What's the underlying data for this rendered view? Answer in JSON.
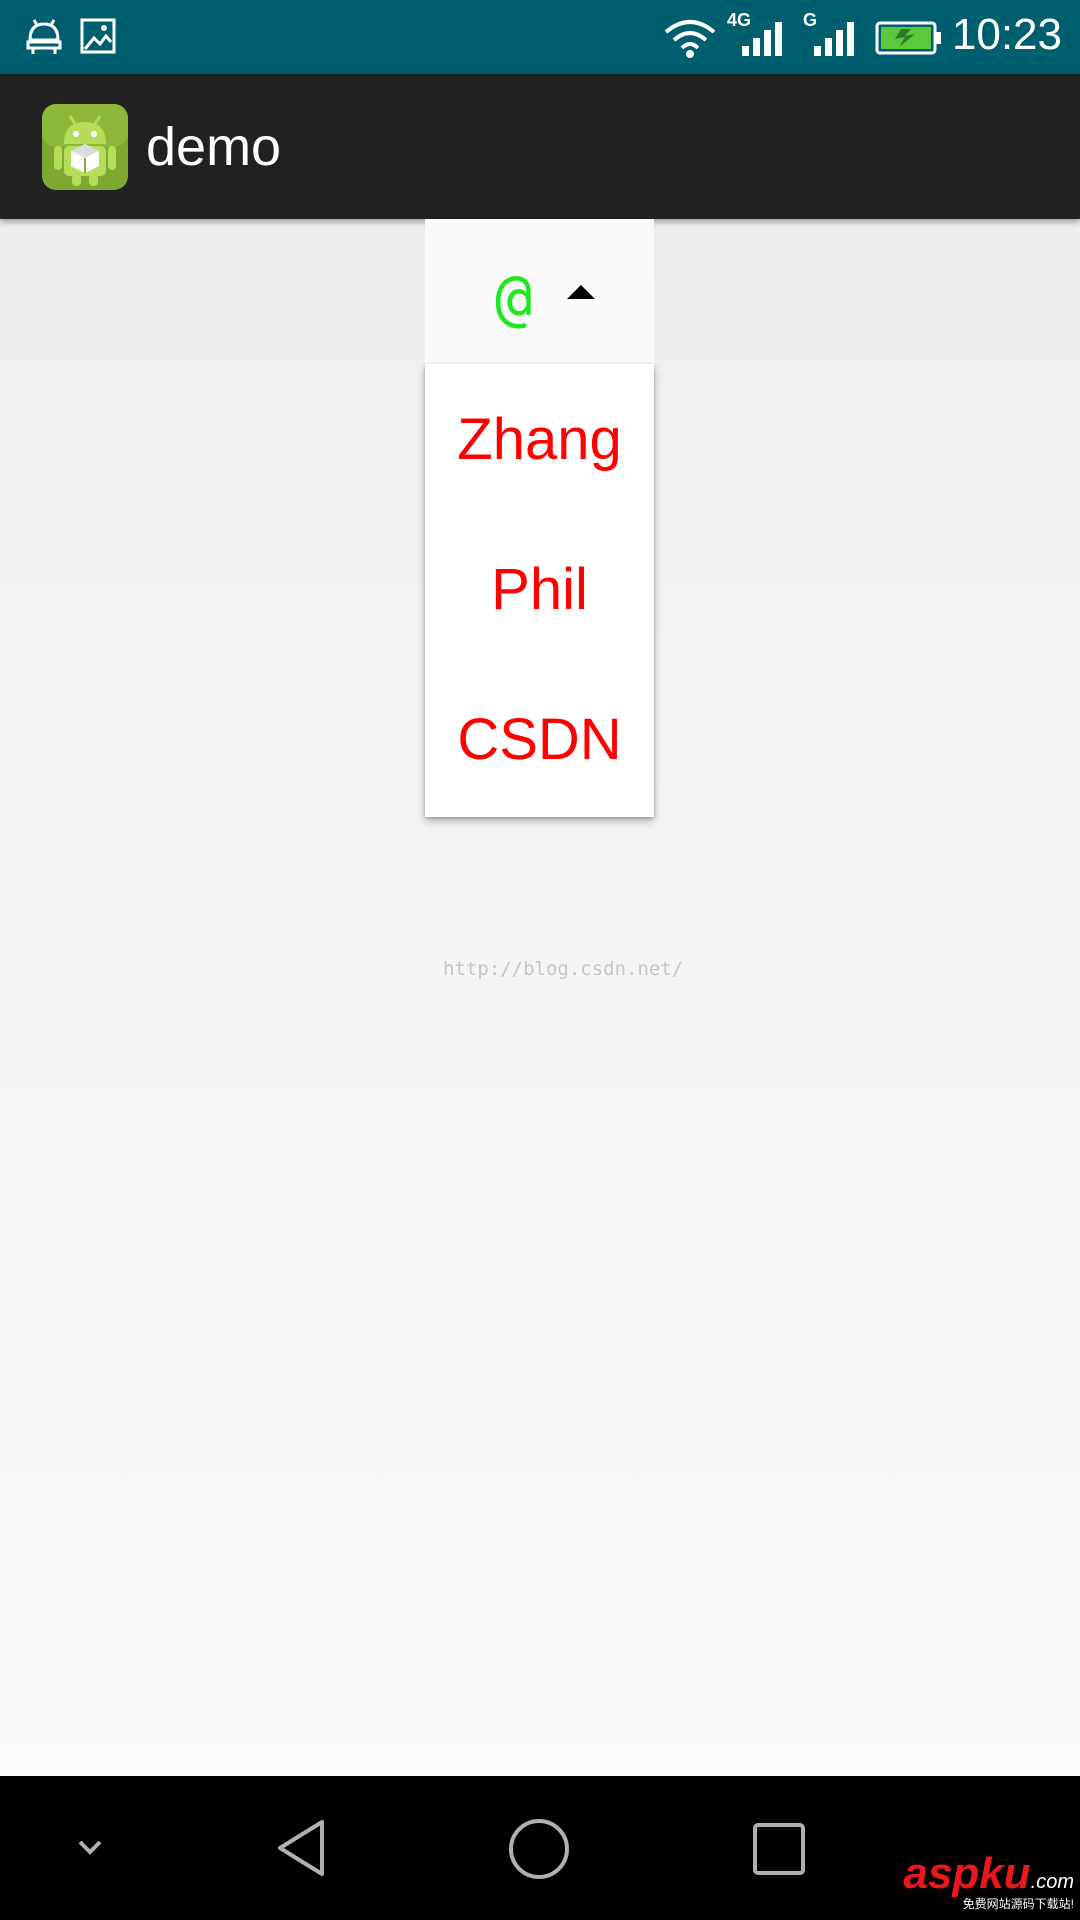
{
  "status_bar": {
    "time": "10:23",
    "network_primary": "4G",
    "network_secondary": "G",
    "left_icons": [
      "android-notification-icon",
      "image-notification-icon"
    ],
    "right_icons": [
      "wifi-icon",
      "signal-4g-icon",
      "signal-g-icon",
      "battery-charging-icon"
    ]
  },
  "app_bar": {
    "title": "demo",
    "icon": "android-app-icon"
  },
  "spinner": {
    "selected": "@",
    "indicator": "triangle-up-icon",
    "options": [
      "Zhang",
      "Phil",
      "CSDN"
    ]
  },
  "watermark": "http://blog.csdn.net/",
  "nav_bar": {
    "buttons": [
      "hide-nav-icon",
      "back-icon",
      "home-icon",
      "recents-icon"
    ]
  },
  "site_logo": {
    "brand": "aspku",
    "tld": ".com",
    "tagline": "免费网站源码下载站!"
  },
  "colors": {
    "status_bar": "#005f6e",
    "app_bar": "#212121",
    "selected_text": "#1ee81e",
    "option_text": "#ff0000",
    "nav_bar": "#000000"
  }
}
